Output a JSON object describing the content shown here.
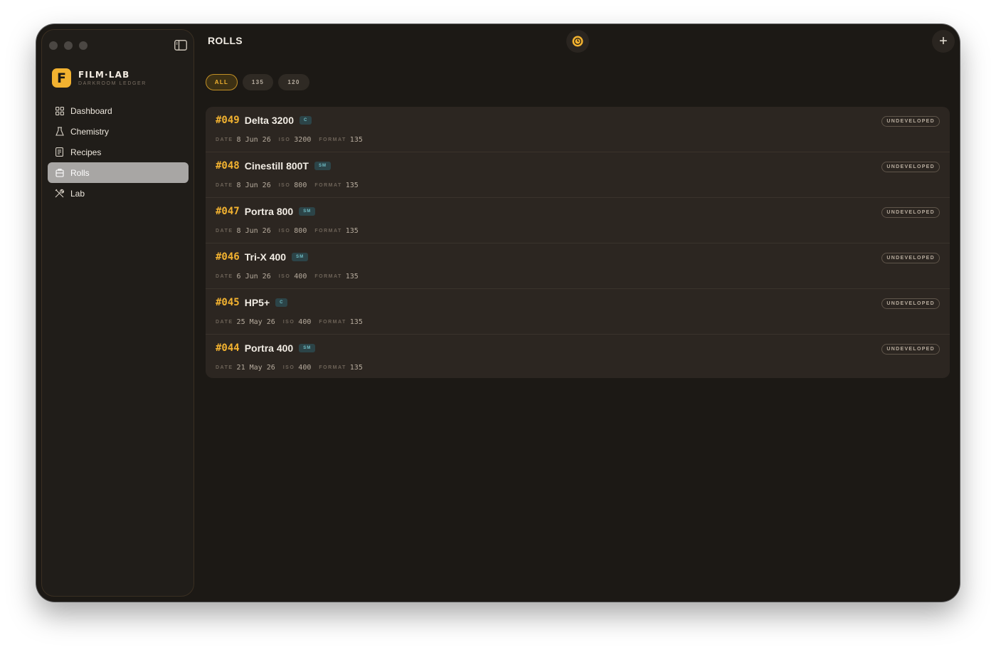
{
  "app": {
    "brand_name": "FILM·LAB",
    "brand_subtitle": "DARKROOM LEDGER",
    "logo_letter": "F",
    "accent_color": "#f2b230"
  },
  "sidebar": {
    "items": [
      {
        "label": "Dashboard",
        "icon": "grid-icon"
      },
      {
        "label": "Chemistry",
        "icon": "flask-icon"
      },
      {
        "label": "Recipes",
        "icon": "document-icon"
      },
      {
        "label": "Rolls",
        "icon": "film-canister-icon",
        "active": true
      },
      {
        "label": "Lab",
        "icon": "tools-icon"
      }
    ]
  },
  "header": {
    "title": "ROLLS",
    "add_label": "+"
  },
  "filters": [
    "ALL",
    "135",
    "120"
  ],
  "active_filter": "ALL",
  "meta_labels": {
    "date": "DATE",
    "iso": "ISO",
    "format": "FORMAT"
  },
  "rolls": [
    {
      "number": "#049",
      "name": "Delta 3200",
      "tag": "C",
      "date": "8 Jun 26",
      "iso": "3200",
      "format": "135",
      "status": "UNDEVELOPED"
    },
    {
      "number": "#048",
      "name": "Cinestill 800T",
      "tag": "SM",
      "date": "8 Jun 26",
      "iso": "800",
      "format": "135",
      "status": "UNDEVELOPED"
    },
    {
      "number": "#047",
      "name": "Portra 800",
      "tag": "SM",
      "date": "8 Jun 26",
      "iso": "800",
      "format": "135",
      "status": "UNDEVELOPED"
    },
    {
      "number": "#046",
      "name": "Tri-X 400",
      "tag": "SM",
      "date": "6 Jun 26",
      "iso": "400",
      "format": "135",
      "status": "UNDEVELOPED"
    },
    {
      "number": "#045",
      "name": "HP5+",
      "tag": "C",
      "date": "25 May 26",
      "iso": "400",
      "format": "135",
      "status": "UNDEVELOPED"
    },
    {
      "number": "#044",
      "name": "Portra 400",
      "tag": "SM",
      "date": "21 May 26",
      "iso": "400",
      "format": "135",
      "status": "UNDEVELOPED"
    }
  ]
}
